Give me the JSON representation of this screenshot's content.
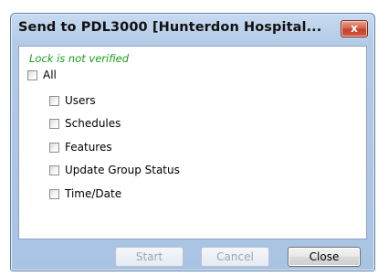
{
  "window": {
    "title": "Send to PDL3000 [Hunterdon Hospital...",
    "close_glyph": "x"
  },
  "status": {
    "lock_text": "Lock is not verified",
    "lock_color": "#17a017"
  },
  "options": {
    "all": {
      "label": "All",
      "checked": false
    },
    "items": [
      {
        "label": "Users",
        "checked": false
      },
      {
        "label": "Schedules",
        "checked": false
      },
      {
        "label": "Features",
        "checked": false
      },
      {
        "label": "Update Group Status",
        "checked": false
      },
      {
        "label": "Time/Date",
        "checked": false
      }
    ]
  },
  "buttons": {
    "start": {
      "label": "Start",
      "enabled": false
    },
    "cancel": {
      "label": "Cancel",
      "enabled": false
    },
    "close": {
      "label": "Close",
      "enabled": true
    }
  },
  "colors": {
    "frame": "#b4cbe7",
    "close_button": "#c5412a"
  }
}
